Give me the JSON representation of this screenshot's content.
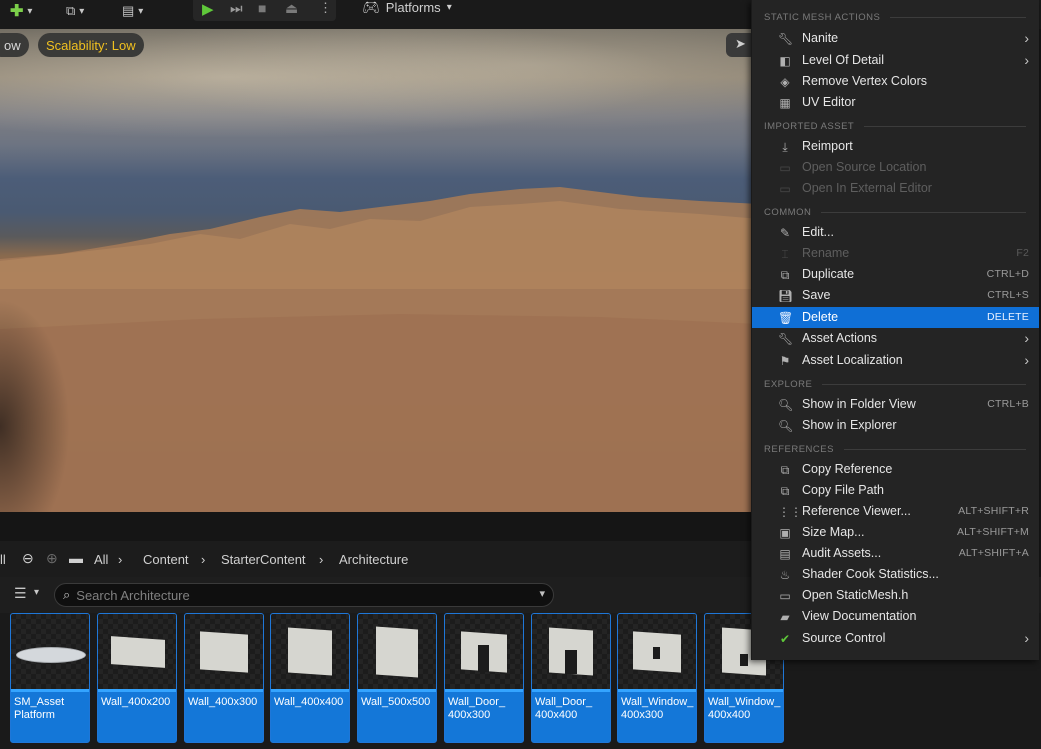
{
  "toolbar": {
    "platforms_label": "Platforms"
  },
  "viewport": {
    "left_pill": "ow",
    "scalability": "Scalability: Low"
  },
  "content_browser": {
    "left_edge_label": "ll",
    "breadcrumbs": [
      "All",
      "Content",
      "StarterContent",
      "Architecture"
    ],
    "search_placeholder": "Search Architecture",
    "assets": [
      {
        "name": "SM_Asset Platform"
      },
      {
        "name": "Wall_400x200"
      },
      {
        "name": "Wall_400x300"
      },
      {
        "name": "Wall_400x400"
      },
      {
        "name": "Wall_500x500"
      },
      {
        "name": "Wall_Door_ 400x300"
      },
      {
        "name": "Wall_Door_ 400x400"
      },
      {
        "name": "Wall_Window_ 400x300"
      },
      {
        "name": "Wall_Window_ 400x400"
      }
    ]
  },
  "menu": {
    "sections": {
      "static_mesh": "STATIC MESH ACTIONS",
      "imported": "IMPORTED ASSET",
      "common": "COMMON",
      "explore": "EXPLORE",
      "references": "REFERENCES"
    },
    "items": {
      "nanite": "Nanite",
      "lod": "Level Of Detail",
      "remove_vertex_colors": "Remove Vertex Colors",
      "uv_editor": "UV Editor",
      "reimport": "Reimport",
      "open_source_location": "Open Source Location",
      "open_external_editor": "Open In External Editor",
      "edit": "Edit...",
      "rename": "Rename",
      "rename_sc": "F2",
      "duplicate": "Duplicate",
      "duplicate_sc": "CTRL+D",
      "save": "Save",
      "save_sc": "CTRL+S",
      "delete": "Delete",
      "delete_sc": "DELETE",
      "asset_actions": "Asset Actions",
      "asset_localization": "Asset Localization",
      "show_folder_view": "Show in Folder View",
      "show_folder_view_sc": "CTRL+B",
      "show_explorer": "Show in Explorer",
      "copy_reference": "Copy Reference",
      "copy_file_path": "Copy File Path",
      "reference_viewer": "Reference Viewer...",
      "reference_viewer_sc": "ALT+SHIFT+R",
      "size_map": "Size Map...",
      "size_map_sc": "ALT+SHIFT+M",
      "audit_assets": "Audit Assets...",
      "audit_assets_sc": "ALT+SHIFT+A",
      "shader_cook": "Shader Cook Statistics...",
      "open_header": "Open StaticMesh.h",
      "view_docs": "View Documentation",
      "source_control": "Source Control"
    }
  }
}
